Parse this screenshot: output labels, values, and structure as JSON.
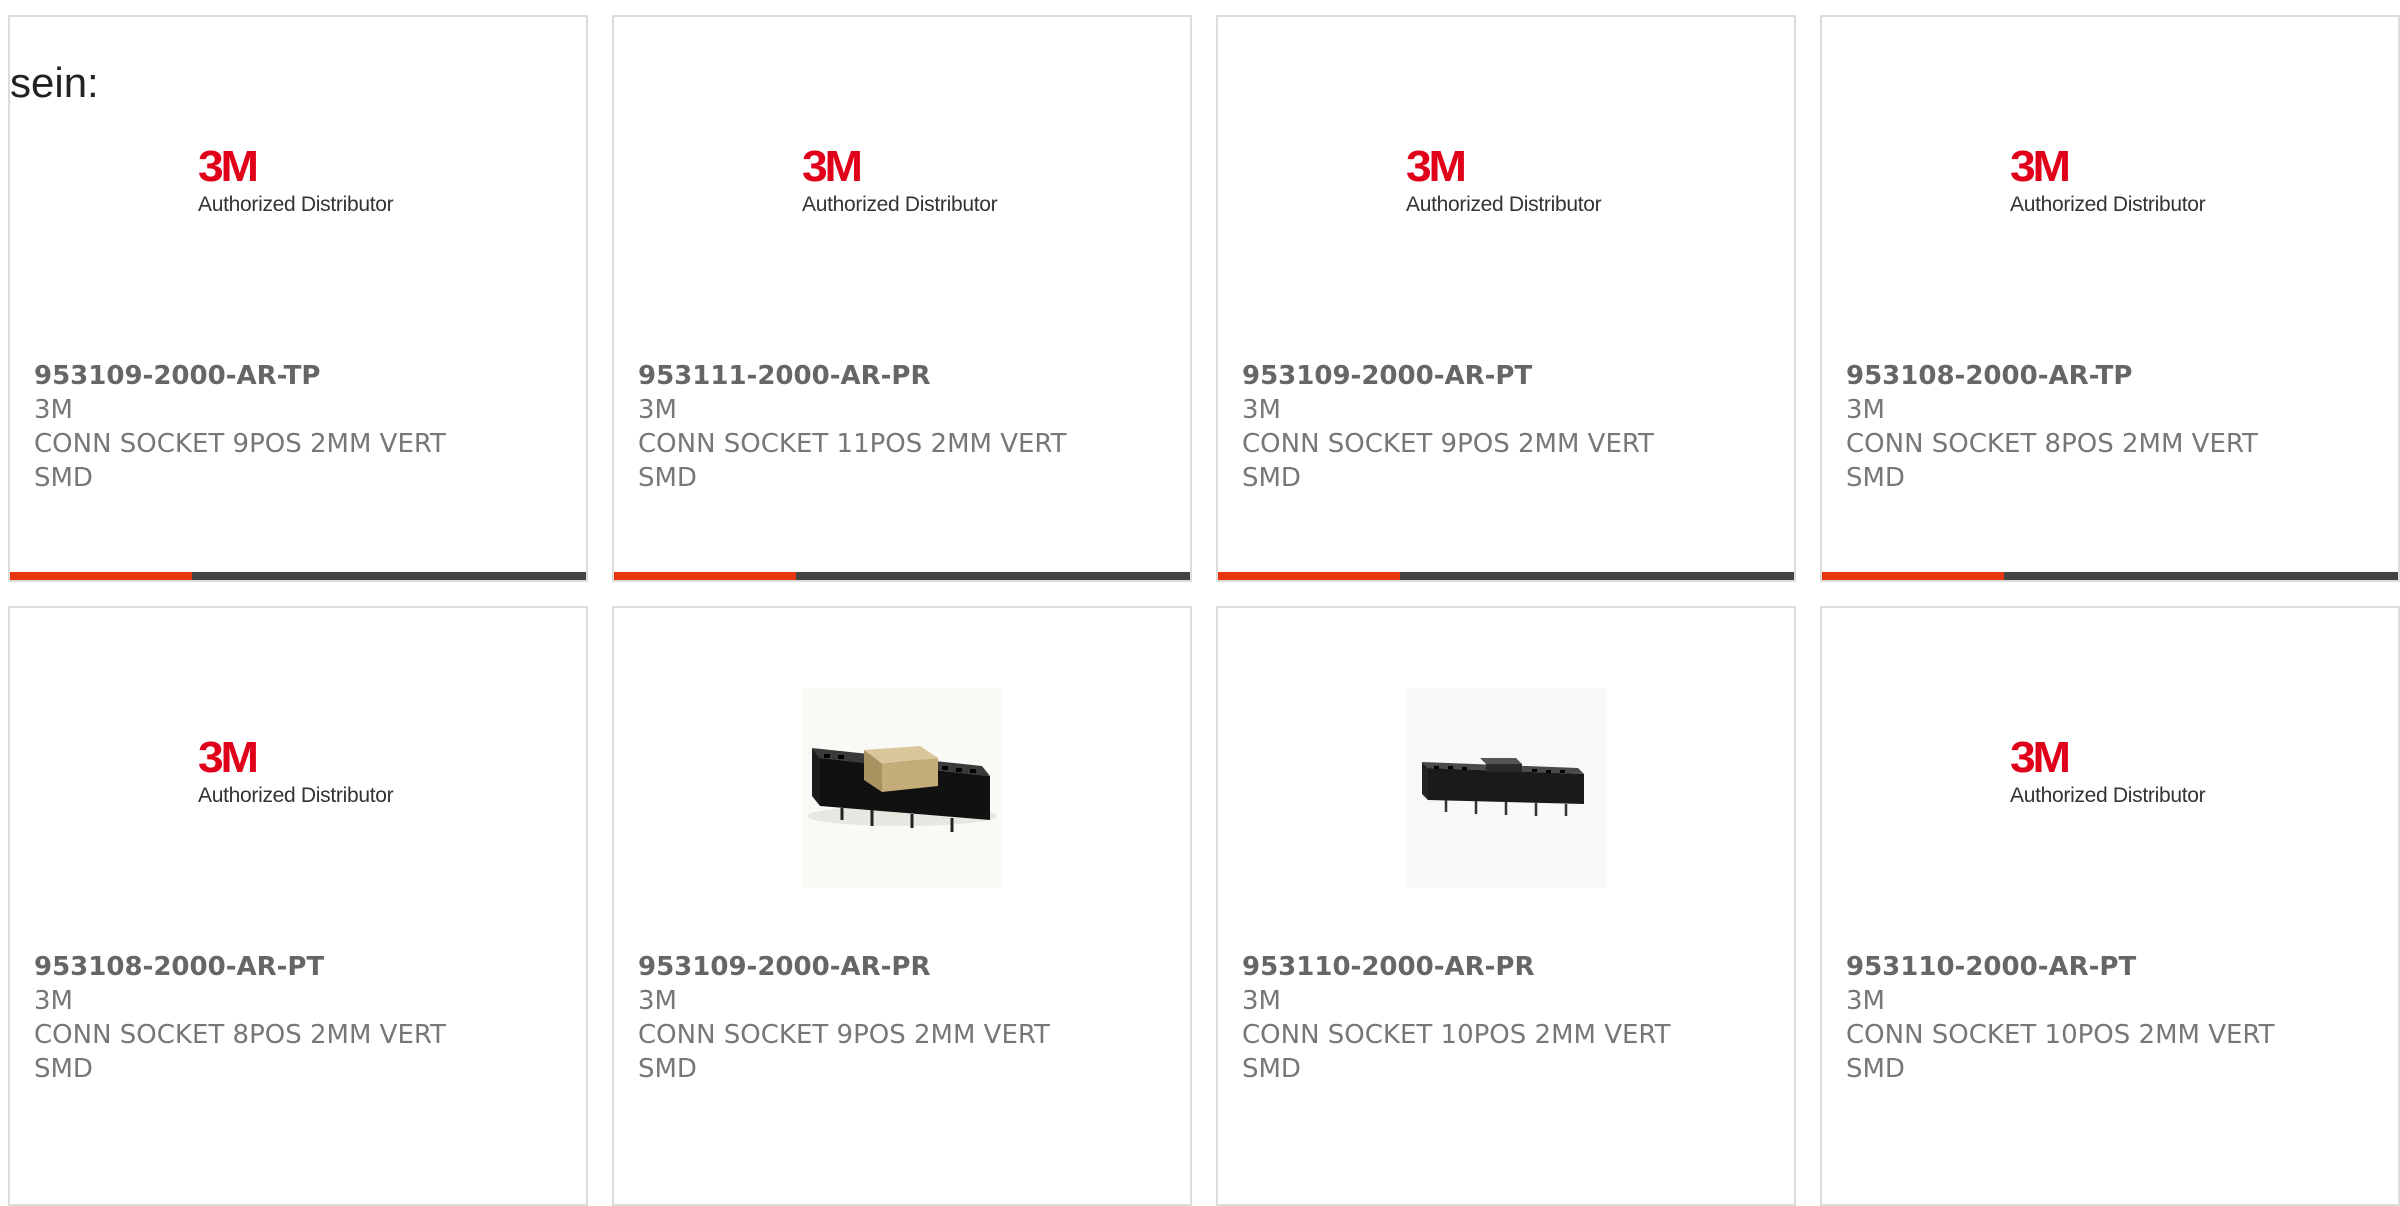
{
  "intro_text": "sein:",
  "logo": {
    "brand": "3M",
    "tagline": "Authorized Distributor"
  },
  "colors": {
    "accent": "#e8360e",
    "bar": "#444444",
    "brand_red": "#e1001a",
    "text": "#777777"
  },
  "products": [
    {
      "part_number": "953109-2000-AR-TP",
      "manufacturer": "3M",
      "description_line1": "CONN SOCKET 9POS 2MM VERT",
      "description_line2": "SMD",
      "image": "3m-logo"
    },
    {
      "part_number": "953111-2000-AR-PR",
      "manufacturer": "3M",
      "description_line1": "CONN SOCKET 11POS 2MM VERT",
      "description_line2": "SMD",
      "image": "3m-logo"
    },
    {
      "part_number": "953109-2000-AR-PT",
      "manufacturer": "3M",
      "description_line1": "CONN SOCKET 9POS 2MM VERT",
      "description_line2": "SMD",
      "image": "3m-logo"
    },
    {
      "part_number": "953108-2000-AR-TP",
      "manufacturer": "3M",
      "description_line1": "CONN SOCKET 8POS 2MM VERT",
      "description_line2": "SMD",
      "image": "3m-logo"
    },
    {
      "part_number": "953108-2000-AR-PT",
      "manufacturer": "3M",
      "description_line1": "CONN SOCKET 8POS 2MM VERT",
      "description_line2": "SMD",
      "image": "3m-logo"
    },
    {
      "part_number": "953109-2000-AR-PR",
      "manufacturer": "3M",
      "description_line1": "CONN SOCKET 9POS 2MM VERT",
      "description_line2": "SMD",
      "image": "connector-photo-gold"
    },
    {
      "part_number": "953110-2000-AR-PR",
      "manufacturer": "3M",
      "description_line1": "CONN SOCKET 10POS 2MM VERT",
      "description_line2": "SMD",
      "image": "connector-photo-black"
    },
    {
      "part_number": "953110-2000-AR-PT",
      "manufacturer": "3M",
      "description_line1": "CONN SOCKET 10POS 2MM VERT",
      "description_line2": "SMD",
      "image": "3m-logo"
    }
  ]
}
